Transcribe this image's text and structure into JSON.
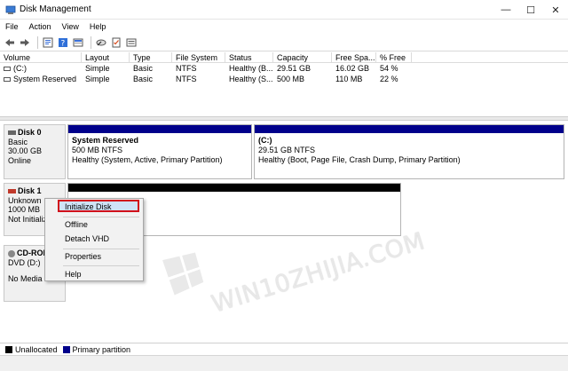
{
  "window": {
    "title": "Disk Management"
  },
  "titlebar_controls": {
    "minimize": "—",
    "maximize": "☐",
    "close": "✕"
  },
  "menu": [
    "File",
    "Action",
    "View",
    "Help"
  ],
  "toolbar_icons": [
    "back-icon",
    "forward-icon",
    "properties-icon",
    "help-icon",
    "disk-list-icon",
    "rescan-icon",
    "checklist-icon",
    "options-icon"
  ],
  "volume_table": {
    "headers": [
      "Volume",
      "Layout",
      "Type",
      "File System",
      "Status",
      "Capacity",
      "Free Spa...",
      "% Free"
    ],
    "rows": [
      [
        "(C:)",
        "Simple",
        "Basic",
        "NTFS",
        "Healthy (B...",
        "29.51 GB",
        "16.02 GB",
        "54 %"
      ],
      [
        "System Reserved",
        "Simple",
        "Basic",
        "NTFS",
        "Healthy (S...",
        "500 MB",
        "110 MB",
        "22 %"
      ]
    ]
  },
  "disks": {
    "disk0": {
      "name": "Disk 0",
      "type": "Basic",
      "size": "30.00 GB",
      "status": "Online",
      "partitions": [
        {
          "name": "System Reserved",
          "size": "500 MB NTFS",
          "status": "Healthy (System, Active, Primary Partition)"
        },
        {
          "name": "(C:)",
          "size": "29.51 GB NTFS",
          "status": "Healthy (Boot, Page File, Crash Dump, Primary Partition)"
        }
      ]
    },
    "disk1": {
      "name": "Disk 1",
      "type": "Unknown",
      "size": "1000 MB",
      "status": "Not Initializ"
    },
    "cdrom": {
      "name": "CD-ROI",
      "type": "DVD (D:)",
      "status": "No Media"
    }
  },
  "context_menu": {
    "items": [
      "Initialize Disk",
      "Offline",
      "Detach VHD",
      "Properties",
      "Help"
    ],
    "highlight_color": "#d1101b"
  },
  "watermark": {
    "text": "WIN10ZHIJIA.COM"
  },
  "legend": [
    {
      "label": "Unallocated",
      "color": "#000000"
    },
    {
      "label": "Primary partition",
      "color": "#00008b"
    }
  ]
}
